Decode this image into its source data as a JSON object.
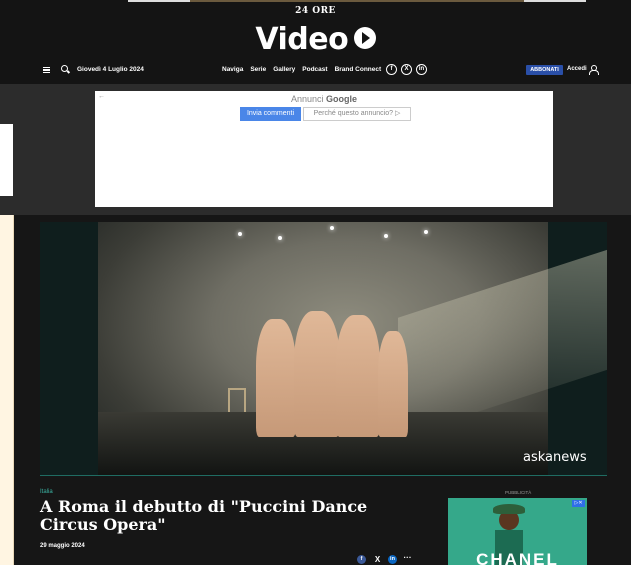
{
  "header": {
    "masthead": "24 ORE",
    "brand": "Video",
    "date": "Giovedì 4 Luglio 2024",
    "nav": [
      "Naviga",
      "Serie",
      "Gallery",
      "Podcast",
      "Brand Connect"
    ],
    "social": {
      "facebook": "f",
      "x": "X",
      "linkedin": "in"
    },
    "subscribe_label": "ABBONATI",
    "login_label": "Accedi"
  },
  "ad": {
    "label_prefix": "Annunci",
    "label_brand": "Google",
    "back_glyph": "←",
    "send_feedback": "Invia commenti",
    "why_ad": "Perché questo annuncio? ▷"
  },
  "video": {
    "watermark": "askanews"
  },
  "article": {
    "category": "Italia",
    "title": "A Roma il debutto di \"Puccini Dance Circus Opera\"",
    "date": "29 maggio 2024",
    "share": {
      "facebook": "f",
      "x": "X",
      "linkedin": "in",
      "more": "···"
    }
  },
  "side_ad": {
    "label": "PUBBLICITÀ",
    "corner": "▷✕",
    "brand": "CHANEL"
  },
  "colors": {
    "background": "#161616",
    "accent_teal": "#3bb3a3",
    "subscribe_blue": "#2a4fa8",
    "ad_button_blue": "#4a86e8"
  }
}
